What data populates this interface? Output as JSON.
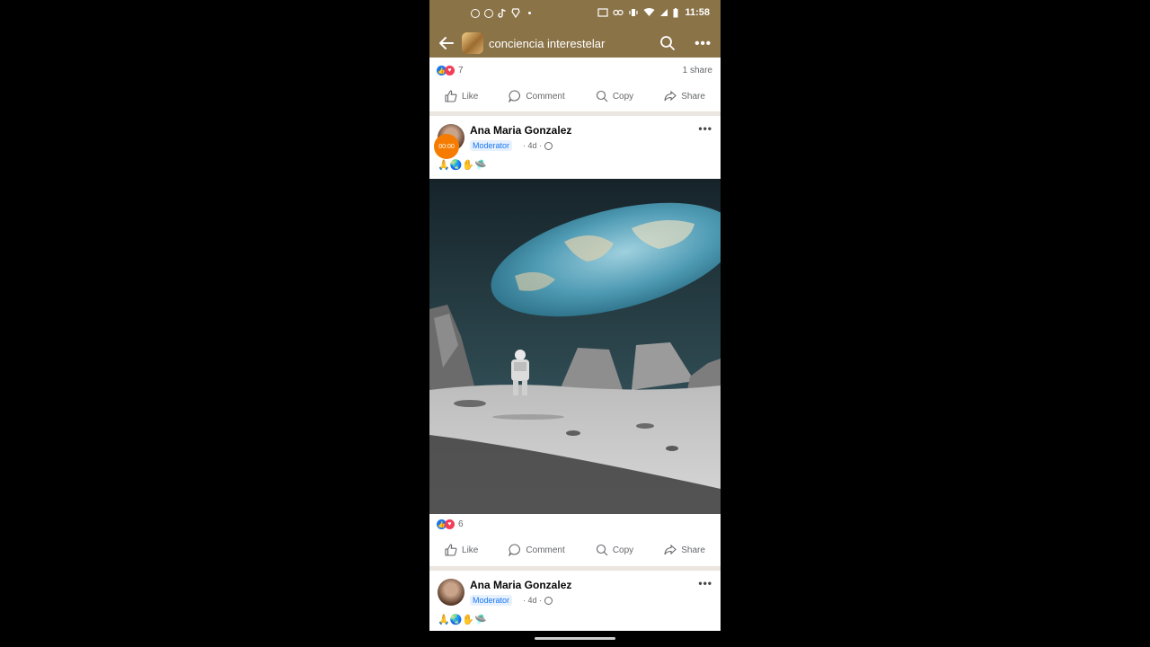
{
  "status_bar": {
    "time": "11:58",
    "icons_left": [
      "whatsapp-icon",
      "messenger-icon",
      "tiktok-icon",
      "brave-icon",
      "dot-icon"
    ],
    "icons_right": [
      "cast-icon",
      "link-icon",
      "vibrate-icon",
      "wifi-icon",
      "signal-icon",
      "battery-icon"
    ]
  },
  "app_bar": {
    "title": "conciencia interestelar",
    "back_icon": "arrow-left-icon",
    "search_icon": "search-icon",
    "more_icon": "more-icon",
    "more_label": "•••"
  },
  "actions": {
    "like": "Like",
    "comment": "Comment",
    "copy": "Copy",
    "share": "Share"
  },
  "top_post": {
    "reaction_count": "7",
    "shares": "1 share"
  },
  "post": {
    "author": "Ana Maria Gonzalez",
    "badge": "Moderator",
    "time": "· 4d ·",
    "emojis": "🙏🌏✋🛸",
    "timer": "00:00",
    "more_label": "•••",
    "reaction_count": "6"
  },
  "next_post": {
    "author": "Ana Maria Gonzalez",
    "badge": "Moderator",
    "time": "· 4d ·",
    "emojis": "🙏🌏✋🛸",
    "more_label": "•••"
  },
  "colors": {
    "header_brown": "#8b7348",
    "facebook_blue": "#1877f2",
    "love_red": "#f33e58",
    "timer_orange": "#f57c00"
  }
}
